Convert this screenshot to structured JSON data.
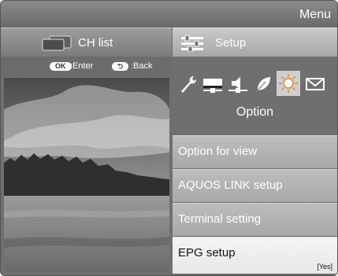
{
  "header": {
    "title": "Menu"
  },
  "tabs": {
    "ch_list": {
      "label": "CH list"
    },
    "setup": {
      "label": "Setup"
    }
  },
  "help": {
    "ok_key": "OK",
    "ok_text": ":Enter",
    "back_key": "⮌",
    "back_text": ":Back"
  },
  "category_icons": [
    "wrench-icon",
    "picture-icon",
    "speaker-icon",
    "leaf-icon",
    "option-sun-icon",
    "mail-icon"
  ],
  "selected_category": "Option",
  "menu_items": [
    {
      "label": "Option for view",
      "value": ""
    },
    {
      "label": "AQUOS LINK setup",
      "value": ""
    },
    {
      "label": "Terminal setting",
      "value": ""
    },
    {
      "label": "EPG setup",
      "value": "[Yes]"
    }
  ]
}
